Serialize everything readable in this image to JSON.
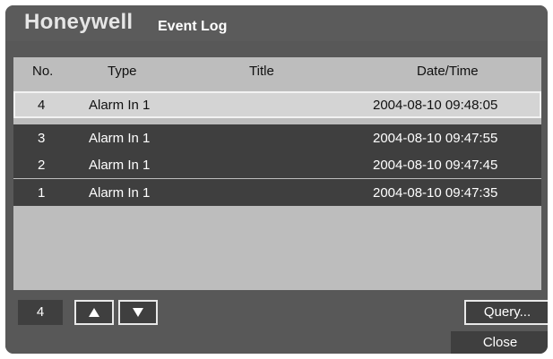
{
  "header": {
    "brand": "Honeywell",
    "title": "Event Log"
  },
  "table": {
    "columns": {
      "no": "No.",
      "type": "Type",
      "title": "Title",
      "datetime": "Date/Time"
    },
    "rows": [
      {
        "no": "4",
        "type": "Alarm In 1",
        "title": "",
        "datetime": "2004-08-10 09:48:05",
        "selected": true
      },
      {
        "no": "3",
        "type": "Alarm In 1",
        "title": "",
        "datetime": "2004-08-10 09:47:55",
        "selected": false
      },
      {
        "no": "2",
        "type": "Alarm In 1",
        "title": "",
        "datetime": "2004-08-10 09:47:45",
        "selected": false
      },
      {
        "no": "1",
        "type": "Alarm In 1",
        "title": "",
        "datetime": "2004-08-10 09:47:35",
        "selected": false
      }
    ]
  },
  "controls": {
    "count": "4",
    "query_label": "Query...",
    "close_label": "Close"
  },
  "icons": {
    "up": "triangle-up-icon",
    "down": "triangle-down-icon"
  },
  "colors": {
    "background": "#585858",
    "selected_row": "#d4d4d4",
    "row": "#3f3f3f"
  }
}
